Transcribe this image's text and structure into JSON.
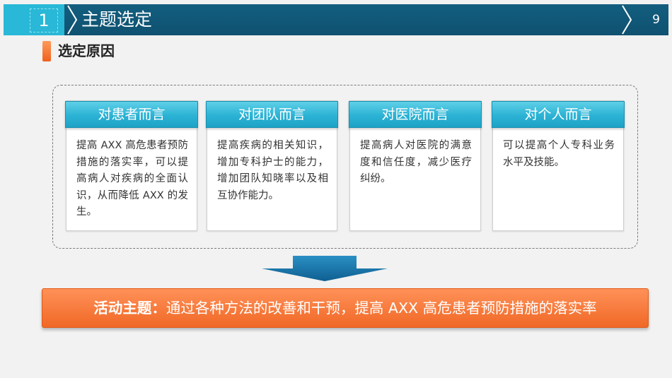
{
  "header": {
    "section_number": "1",
    "title": "主题选定",
    "page_number": "9"
  },
  "section": {
    "heading": "选定原因"
  },
  "cards": [
    {
      "title": "对患者而言",
      "text": "提高 AXX 高危患者预防措施的落实率，可以提高病人对疾病的全面认识，从而降低 AXX 的发生。"
    },
    {
      "title": "对团队而言",
      "text": "提高疾病的相关知识，增加专科护士的能力，增加团队知晓率以及相互协作能力。"
    },
    {
      "title": "对医院而言",
      "text": "提高病人对医院的满意度和信任度，减少医疗纠纷。"
    },
    {
      "title": "对个人而言",
      "text": "可以提高个人专科业务水平及技能。"
    }
  ],
  "theme": {
    "label": "活动主题：",
    "text": "通过各种方法的改善和干预，提高 AXX 高危患者预防措施的落实率"
  },
  "colors": {
    "header_bg": "#135e7f",
    "accent_cyan": "#29b8d7",
    "accent_orange": "#f06826"
  }
}
